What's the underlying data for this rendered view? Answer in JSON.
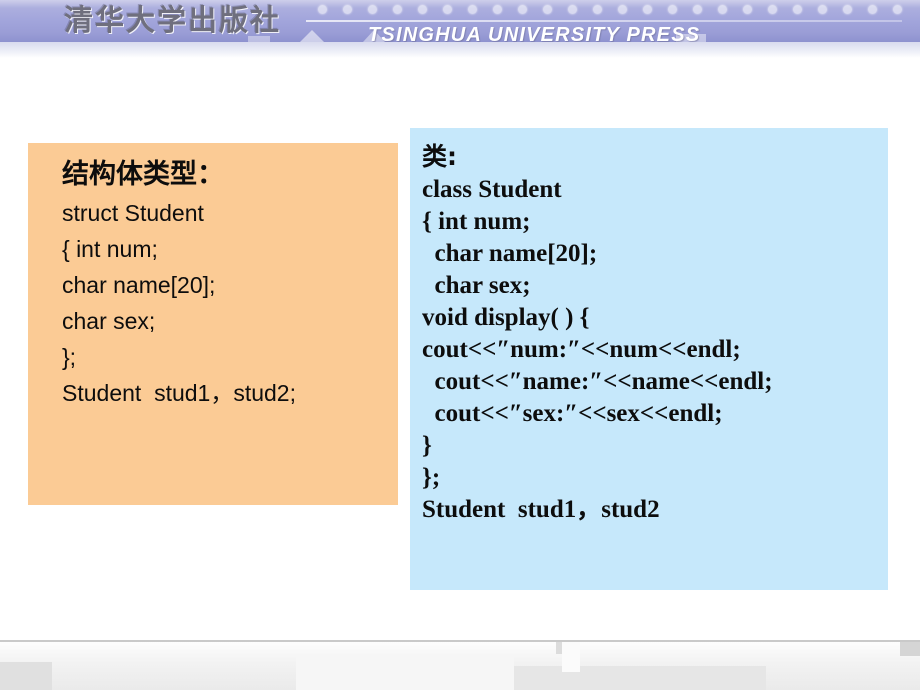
{
  "header": {
    "publisher_cn": "清华大学出版社",
    "publisher_en": "TSINGHUA UNIVERSITY PRESS",
    "band_color": "#a3a6dc",
    "dot_count": 24
  },
  "struct_panel": {
    "background_color": "#fbcb95",
    "heading": "结构体类型：",
    "lines": [
      "struct Student",
      "{ int num;",
      "char name[20];",
      "char sex;",
      "};",
      "Student  stud1，stud2;"
    ]
  },
  "class_panel": {
    "background_color": "#c6e8fb",
    "heading": "类:",
    "lines": [
      "class Student",
      "{ int num;",
      "  char name[20];",
      "  char sex;",
      "void display( ) {",
      "cout<<″num:″<<num<<endl;",
      "  cout<<″name:″<<name<<endl;",
      "  cout<<″sex:″<<sex<<endl;",
      "}",
      "};",
      "Student  stud1，stud2"
    ]
  }
}
